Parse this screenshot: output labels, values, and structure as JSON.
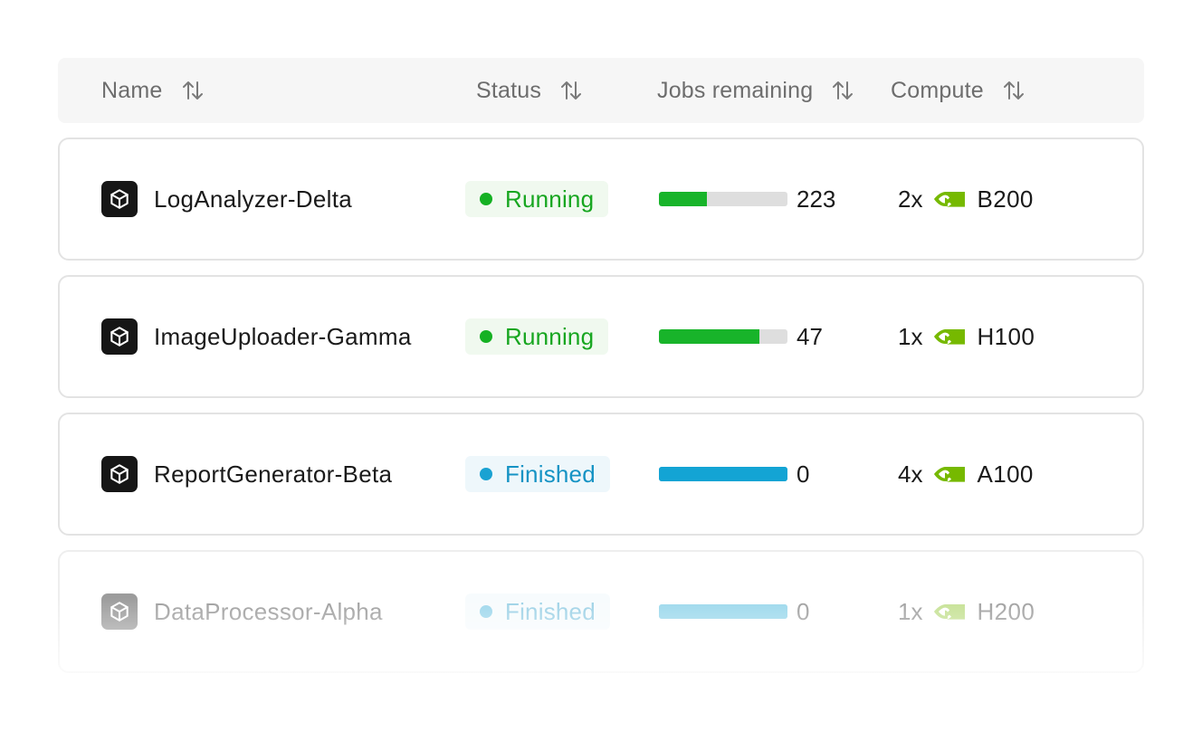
{
  "header": {
    "columns": [
      {
        "label": "Name"
      },
      {
        "label": "Status"
      },
      {
        "label": "Jobs remaining"
      },
      {
        "label": "Compute"
      }
    ]
  },
  "rows": [
    {
      "name": "LogAnalyzer-Delta",
      "status": "Running",
      "status_color": "#17a620",
      "progress_fraction": 0.37,
      "jobs_remaining": "223",
      "gpu_count": "2x",
      "gpu_model": "B200",
      "icon": "cube-icon",
      "gpu_icon": "nvidia-logo-icon"
    },
    {
      "name": "ImageUploader-Gamma",
      "status": "Running",
      "status_color": "#17a620",
      "progress_fraction": 0.78,
      "jobs_remaining": "47",
      "gpu_count": "1x",
      "gpu_model": "H100",
      "icon": "cube-icon",
      "gpu_icon": "nvidia-logo-icon"
    },
    {
      "name": "ReportGenerator-Beta",
      "status": "Finished",
      "status_color": "#1593c4",
      "progress_fraction": 1.0,
      "jobs_remaining": "0",
      "gpu_count": "4x",
      "gpu_model": "A100",
      "icon": "cube-icon",
      "gpu_icon": "nvidia-logo-icon"
    },
    {
      "name": "DataProcessor-Alpha",
      "status": "Finished",
      "status_color": "#1593c4",
      "progress_fraction": 1.0,
      "jobs_remaining": "0",
      "gpu_count": "1x",
      "gpu_model": "H200",
      "icon": "cube-icon",
      "gpu_icon": "nvidia-logo-icon"
    }
  ],
  "colors": {
    "running": "#15b123",
    "finished": "#1aa2d2",
    "nvidia_green": "#76b900"
  }
}
